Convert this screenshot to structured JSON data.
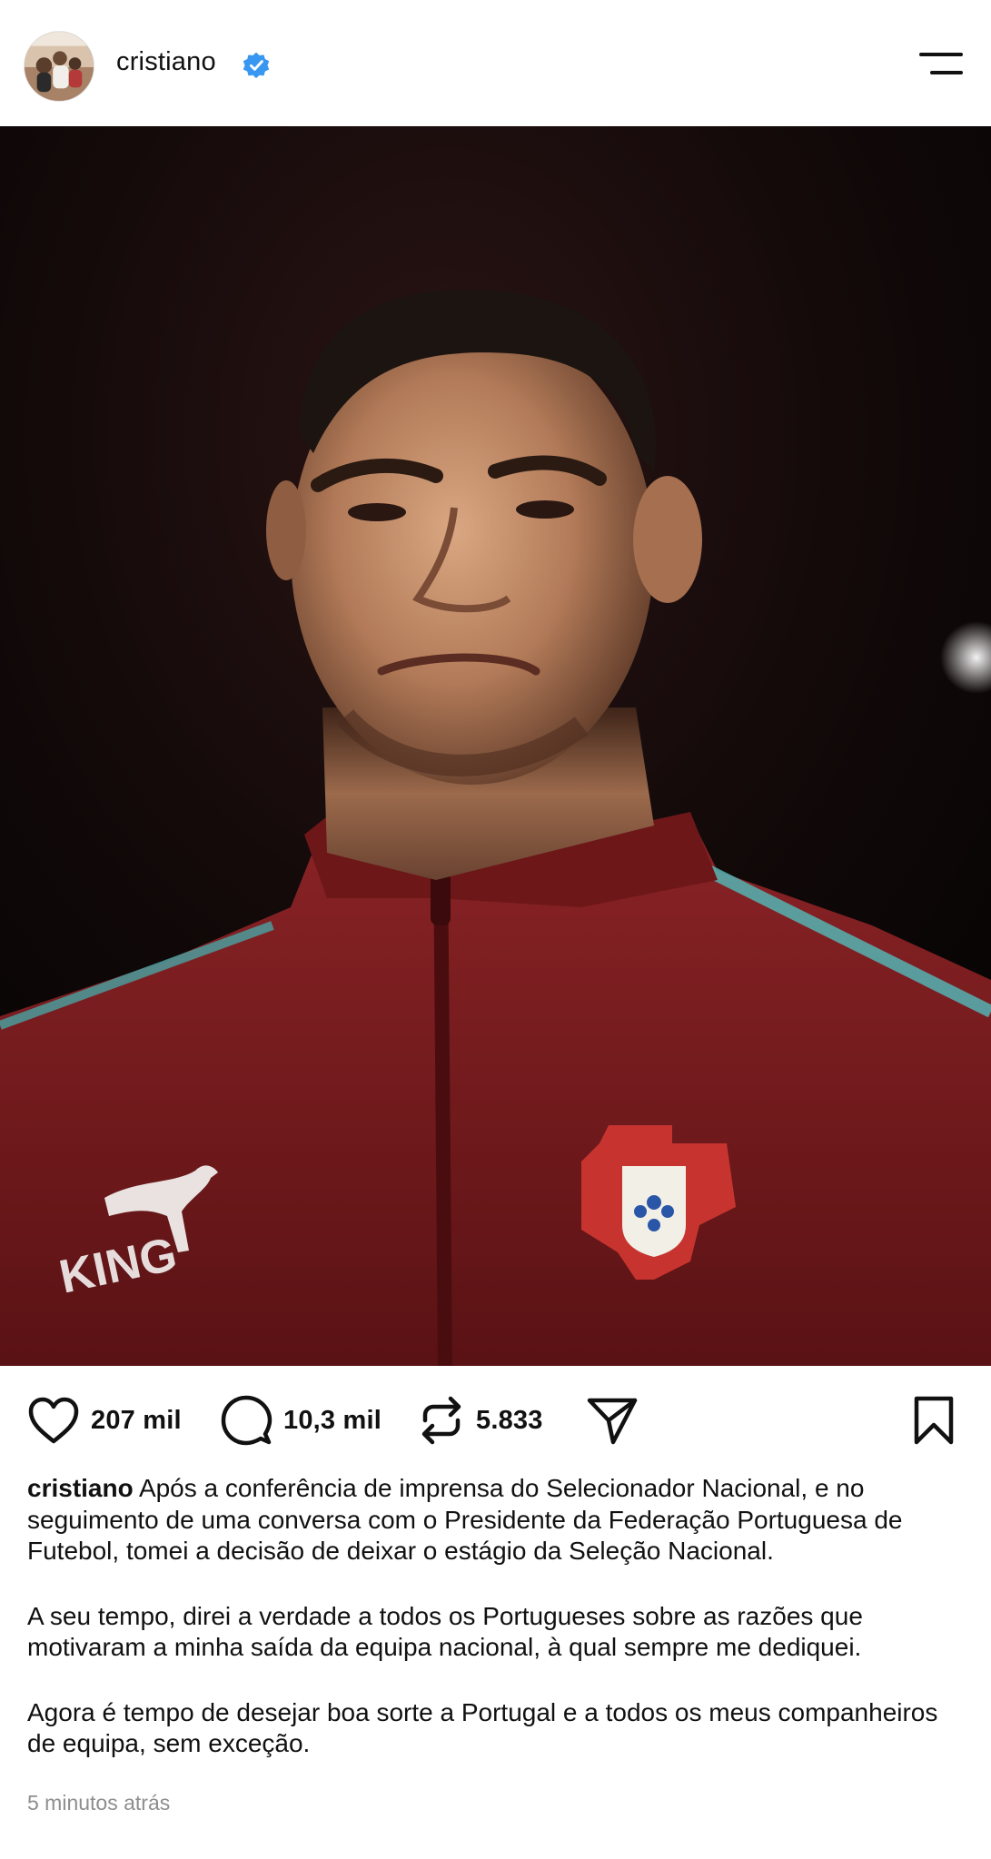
{
  "header": {
    "username": "cristiano",
    "avatar_icon": "profile-photo",
    "verified_icon": "verified-badge-icon",
    "menu_icon": "menu-icon"
  },
  "post_image": {
    "jersey_text": "KING"
  },
  "actions": {
    "likes": "207 mil",
    "comments": "10,3 mil",
    "reposts": "5.833",
    "like_icon": "heart-icon",
    "comment_icon": "comment-icon",
    "repost_icon": "repost-icon",
    "share_icon": "send-icon",
    "save_icon": "bookmark-icon"
  },
  "caption": {
    "username": "cristiano",
    "paragraph1": "Após a conferência de imprensa do Selecionador Nacional, e no seguimento de uma conversa com o Presidente da Federação Portuguesa de Futebol, tomei a decisão de deixar o estágio da Seleção Nacional.",
    "paragraph2": "A seu tempo, direi a verdade a todos os Portugueses sobre as razões que motivaram a minha saída da equipa nacional, à qual sempre me dediquei.",
    "paragraph3": "Agora é tempo de desejar boa sorte a Portugal e a todos os meus companheiros de equipa, sem exceção."
  },
  "timestamp": "5 minutos atrás",
  "colors": {
    "verified_blue": "#3897f0",
    "jersey_red": "#7a1a1c",
    "text": "#111111",
    "muted": "#8e8e8e"
  }
}
